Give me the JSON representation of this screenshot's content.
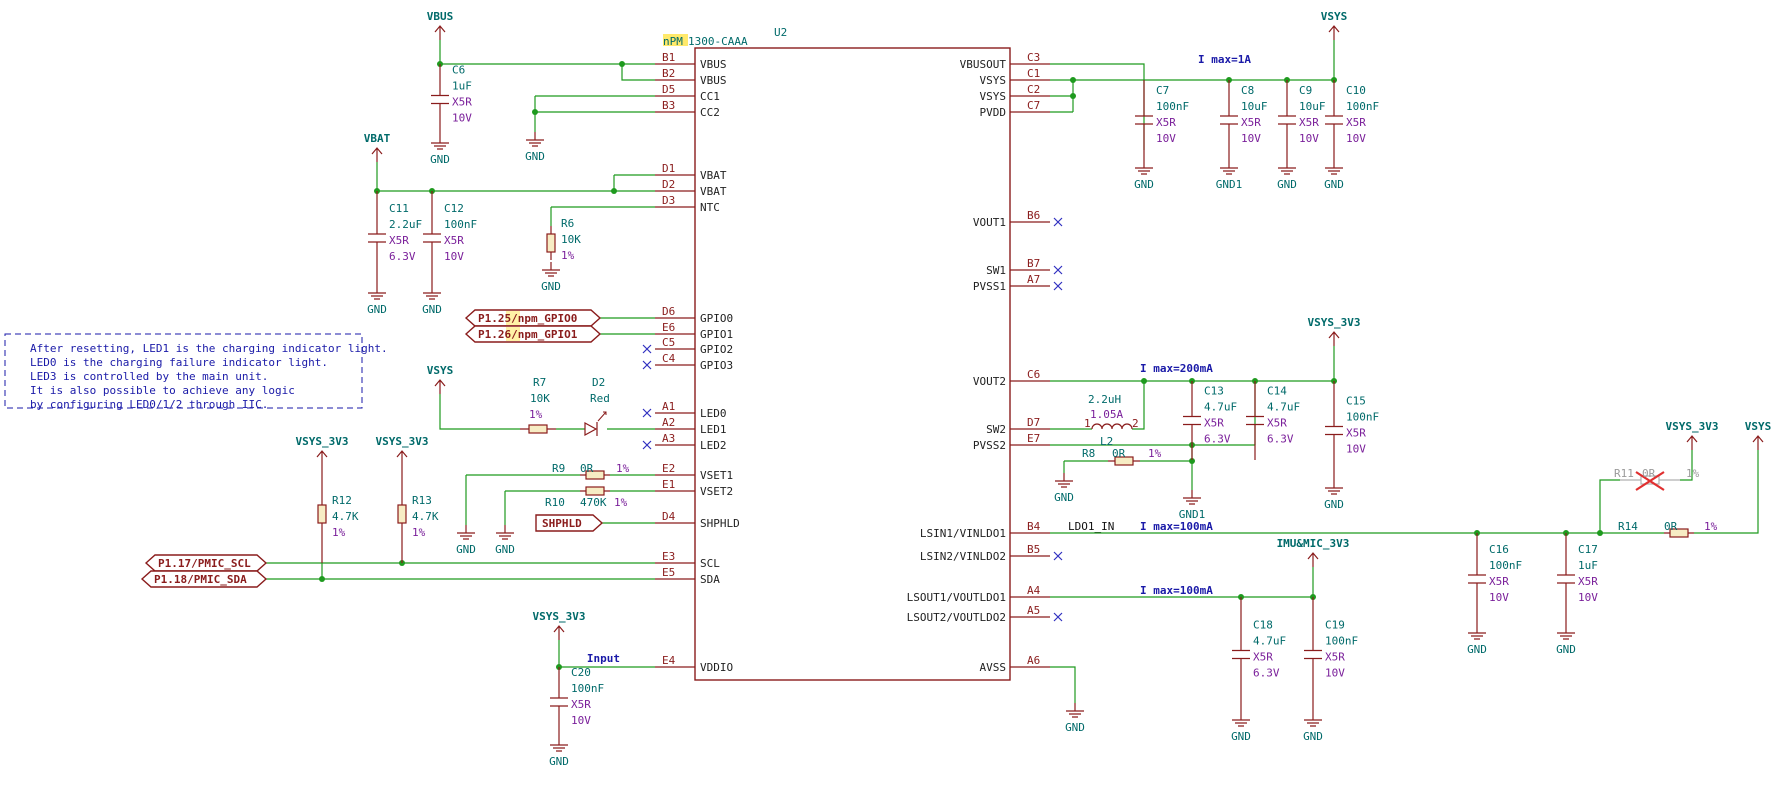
{
  "ic": {
    "ref": "U2",
    "value_prefix": "nPM",
    "value_suffix": "1300-CAAA",
    "left_pins": [
      {
        "num": "B1",
        "name": "VBUS"
      },
      {
        "num": "B2",
        "name": "VBUS"
      },
      {
        "num": "D5",
        "name": "CC1"
      },
      {
        "num": "B3",
        "name": "CC2"
      },
      {
        "num": "D1",
        "name": "VBAT"
      },
      {
        "num": "D2",
        "name": "VBAT"
      },
      {
        "num": "D3",
        "name": "NTC"
      },
      {
        "num": "D6",
        "name": "GPIO0"
      },
      {
        "num": "E6",
        "name": "GPIO1"
      },
      {
        "num": "C5",
        "name": "GPIO2"
      },
      {
        "num": "C4",
        "name": "GPIO3"
      },
      {
        "num": "A1",
        "name": "LED0"
      },
      {
        "num": "A2",
        "name": "LED1"
      },
      {
        "num": "A3",
        "name": "LED2"
      },
      {
        "num": "E2",
        "name": "VSET1"
      },
      {
        "num": "E1",
        "name": "VSET2"
      },
      {
        "num": "D4",
        "name": "SHPHLD"
      },
      {
        "num": "E3",
        "name": "SCL"
      },
      {
        "num": "E5",
        "name": "SDA"
      },
      {
        "num": "E4",
        "name": "VDDIO"
      }
    ],
    "right_pins": [
      {
        "num": "C3",
        "name": "VBUSOUT"
      },
      {
        "num": "C1",
        "name": "VSYS"
      },
      {
        "num": "C2",
        "name": "VSYS"
      },
      {
        "num": "C7",
        "name": "PVDD"
      },
      {
        "num": "B6",
        "name": "VOUT1"
      },
      {
        "num": "B7",
        "name": "SW1"
      },
      {
        "num": "A7",
        "name": "PVSS1"
      },
      {
        "num": "C6",
        "name": "VOUT2"
      },
      {
        "num": "D7",
        "name": "SW2"
      },
      {
        "num": "E7",
        "name": "PVSS2"
      },
      {
        "num": "B4",
        "name": "LSIN1/VINLDO1"
      },
      {
        "num": "B5",
        "name": "LSIN2/VINLDO2"
      },
      {
        "num": "A4",
        "name": "LSOUT1/VOUTLDO1"
      },
      {
        "num": "A5",
        "name": "LSOUT2/VOUTLDO2"
      },
      {
        "num": "A6",
        "name": "AVSS"
      }
    ]
  },
  "power": {
    "vbus": "VBUS",
    "vbat": "VBAT",
    "vsys": "VSYS",
    "vsys_3v3": "VSYS_3V3",
    "imu_mic_3v3": "IMU&MIC_3V3",
    "gnd": "GND",
    "gnd1": "GND1"
  },
  "components": {
    "c6": {
      "ref": "C6",
      "val": "1uF",
      "die": "X5R",
      "volt": "10V"
    },
    "c11": {
      "ref": "C11",
      "val": "2.2uF",
      "die": "X5R",
      "volt": "6.3V"
    },
    "c12": {
      "ref": "C12",
      "val": "100nF",
      "die": "X5R",
      "volt": "10V"
    },
    "r6": {
      "ref": "R6",
      "val": "10K",
      "tol": "1%"
    },
    "r7": {
      "ref": "R7",
      "val": "10K",
      "tol": "1%"
    },
    "d2": {
      "ref": "D2",
      "val": "Red"
    },
    "r9": {
      "ref": "R9",
      "val": "0R",
      "tol": "1%"
    },
    "r10": {
      "ref": "R10",
      "val": "470K",
      "tol": "1%"
    },
    "r12": {
      "ref": "R12",
      "val": "4.7K",
      "tol": "1%"
    },
    "r13": {
      "ref": "R13",
      "val": "4.7K",
      "tol": "1%"
    },
    "c20": {
      "ref": "C20",
      "val": "100nF",
      "die": "X5R",
      "volt": "10V"
    },
    "c7": {
      "ref": "C7",
      "val": "100nF",
      "die": "X5R",
      "volt": "10V"
    },
    "c8": {
      "ref": "C8",
      "val": "10uF",
      "die": "X5R",
      "volt": "10V"
    },
    "c9": {
      "ref": "C9",
      "val": "10uF",
      "die": "X5R",
      "volt": "10V"
    },
    "c10": {
      "ref": "C10",
      "val": "100nF",
      "die": "X5R",
      "volt": "10V"
    },
    "l2": {
      "ref": "L2",
      "val": "2.2uH",
      "cur": "1.05A",
      "p1": "1",
      "p2": "2"
    },
    "r8": {
      "ref": "R8",
      "val": "0R",
      "tol": "1%"
    },
    "c13": {
      "ref": "C13",
      "val": "4.7uF",
      "die": "X5R",
      "volt": "6.3V"
    },
    "c14": {
      "ref": "C14",
      "val": "4.7uF",
      "die": "X5R",
      "volt": "6.3V"
    },
    "c15": {
      "ref": "C15",
      "val": "100nF",
      "die": "X5R",
      "volt": "10V"
    },
    "r11": {
      "ref": "R11",
      "val": "0R",
      "tol": "1%"
    },
    "r14": {
      "ref": "R14",
      "val": "0R",
      "tol": "1%"
    },
    "c16": {
      "ref": "C16",
      "val": "100nF",
      "die": "X5R",
      "volt": "10V"
    },
    "c17": {
      "ref": "C17",
      "val": "1uF",
      "die": "X5R",
      "volt": "10V"
    },
    "c18": {
      "ref": "C18",
      "val": "4.7uF",
      "die": "X5R",
      "volt": "6.3V"
    },
    "c19": {
      "ref": "C19",
      "val": "100nF",
      "die": "X5R",
      "volt": "10V"
    }
  },
  "labels": {
    "gpio0": "P1.25/npm_GPIO0",
    "gpio1": "P1.26/npm_GPIO1",
    "shphld": "SHPHLD",
    "scl": "P1.17/PMIC_SCL",
    "sda": "P1.18/PMIC_SDA",
    "ldo1_in": "LDO1_IN",
    "input": "Input"
  },
  "notes": {
    "imax_1a": "I max=1A",
    "imax_200ma": "I max=200mA",
    "imax_100ma_a": "I max=100mA",
    "imax_100ma_b": "I max=100mA"
  },
  "comment": [
    "After resetting, LED1 is the charging indicator light.",
    "LED0 is the charging failure indicator light.",
    "LED3 is controlled by the main unit.",
    "It is also possible to achieve any logic",
    "by configuring LED0/1/2 through IIC."
  ]
}
